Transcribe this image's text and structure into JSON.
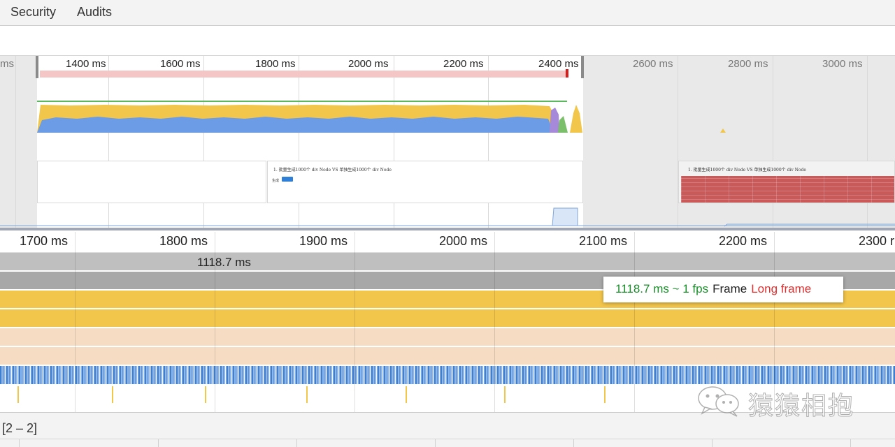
{
  "tabs": [
    {
      "label": "Security"
    },
    {
      "label": "Audits"
    }
  ],
  "overview": {
    "tick_labels": [
      "ms",
      "1400 ms",
      "1600 ms",
      "1800 ms",
      "2000 ms",
      "2200 ms",
      "2400 ms",
      "2600 ms",
      "2800 ms",
      "3000 ms"
    ],
    "screenshot_title": "1. 批量生成1000个 div Node VS 单独生成1000个 div Node",
    "screenshot_button_label": "生成",
    "screenshot2_title": "1. 批量生成1000个 div Node VS 单独生成1000个 div Node"
  },
  "main": {
    "ruler_labels": [
      "1700 ms",
      "1800 ms",
      "1900 ms",
      "2000 ms",
      "2100 ms",
      "2200 ms",
      "2300 r"
    ],
    "frame_duration": "1118.7 ms"
  },
  "tooltip": {
    "fps_text": "1118.7 ms ~ 1 fps",
    "frame_text": "Frame",
    "long_frame_text": "Long frame"
  },
  "bottom": {
    "range_text": "[2 – 2]"
  },
  "watermark": {
    "text": "猿猿相抱"
  },
  "colors": {
    "scripting": "#f2c54b",
    "rendering": "#6c9ce6",
    "painting": "#f5dcc2",
    "long_frame": "#e03030",
    "fps_green": "#1a8e2a"
  }
}
